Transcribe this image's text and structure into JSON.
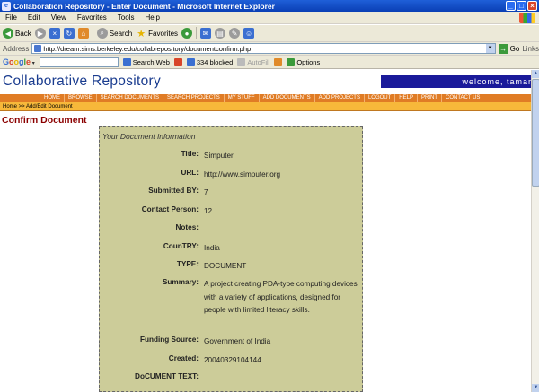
{
  "window": {
    "title": "Collaboration Repository - Enter Document - Microsoft Internet Explorer",
    "buttons": [
      "_",
      "□",
      "×"
    ]
  },
  "menu": [
    "File",
    "Edit",
    "View",
    "Favorites",
    "Tools",
    "Help"
  ],
  "toolbar": {
    "back": "Back",
    "search": "Search",
    "favorites": "Favorites"
  },
  "address": {
    "label": "Address",
    "url": "http://dream.sims.berkeley.edu/collabrepository/documentconfirm.php",
    "go": "Go",
    "links": "Links"
  },
  "googlebar": {
    "logo": "Google",
    "search_web": "Search Web",
    "blocked": "334 blocked",
    "autofill": "AutoFill",
    "options": "Options"
  },
  "site": {
    "title": "Collaborative Repository",
    "welcome": "welcome, tamara",
    "nav": [
      "HOME",
      "BROWSE",
      "SEARCH DOCUMENTS",
      "SEARCH PROJECTS",
      "MY STUFF",
      "ADD DOCUMENTS",
      "ADD PROJECTS",
      "LOGOUT",
      "HELP",
      "PRINT",
      "CONTACT US"
    ],
    "breadcrumb": "Home >> Add/Edit Document",
    "heading": "Confirm Document"
  },
  "panel": {
    "title": "Your Document Information",
    "fields": [
      {
        "label": "Title:",
        "value": "Simputer"
      },
      {
        "label": "URL:",
        "value": "http://www.simputer.org"
      },
      {
        "label": "Submitted BY:",
        "value": "7"
      },
      {
        "label": "Contact Person:",
        "value": "12"
      },
      {
        "label": "Notes:",
        "value": ""
      },
      {
        "label": "CounTRY:",
        "value": "India"
      },
      {
        "label": "TYPE:",
        "value": "DOCUMENT"
      },
      {
        "label": "Summary:",
        "value": "A project creating PDA-type computing devices with a variety of applications, designed for people with limited literacy skills."
      },
      {
        "label": "Funding Source:",
        "value": "Government of India"
      },
      {
        "label": "Created:",
        "value": "20040329104144"
      },
      {
        "label": "DoCUMENT TEXT:",
        "value": ""
      }
    ]
  }
}
